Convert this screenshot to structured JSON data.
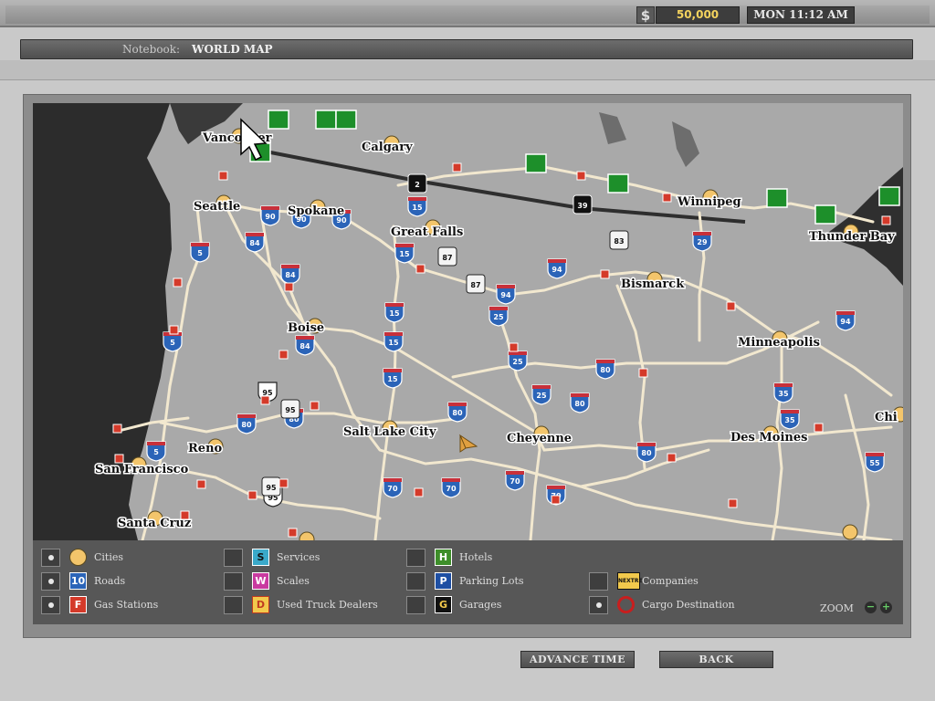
{
  "header": {
    "currency_symbol": "$",
    "money": "50,000",
    "time": "MON 11:12 AM"
  },
  "notebook": {
    "label": "Notebook:",
    "title": "WORLD MAP"
  },
  "map": {
    "cities": [
      {
        "name": "Vancouver"
      },
      {
        "name": "Calgary"
      },
      {
        "name": "Seattle"
      },
      {
        "name": "Spokane"
      },
      {
        "name": "Great Falls"
      },
      {
        "name": "Winnipeg"
      },
      {
        "name": "Thunder Bay"
      },
      {
        "name": "Bismarck"
      },
      {
        "name": "Boise"
      },
      {
        "name": "Minneapolis"
      },
      {
        "name": "Salt Lake City"
      },
      {
        "name": "Cheyenne"
      },
      {
        "name": "Des Moines"
      },
      {
        "name": "Chi"
      },
      {
        "name": "Reno"
      },
      {
        "name": "San Francisco"
      },
      {
        "name": "Santa Cruz"
      }
    ],
    "interstates": [
      "90",
      "90",
      "90",
      "84",
      "84",
      "84",
      "5",
      "5",
      "5",
      "15",
      "15",
      "15",
      "15",
      "15",
      "94",
      "94",
      "94",
      "29",
      "25",
      "25",
      "25",
      "80",
      "80",
      "80",
      "80",
      "80",
      "80",
      "35",
      "35",
      "55",
      "70",
      "70",
      "70",
      "70",
      "95",
      "95"
    ],
    "us_routes": [
      "2",
      "39",
      "83",
      "87",
      "87",
      "95",
      "95"
    ],
    "colors": {
      "land": "#a9a9a9",
      "water": "#2c2c2c",
      "road": "#f2e8cf",
      "interstate": "#2b64b8",
      "city": "#f3c56b"
    }
  },
  "legend": {
    "items": [
      {
        "label": "Cities",
        "icon": "city-icon",
        "checked": true
      },
      {
        "label": "Roads",
        "icon": "interstate-shield-icon",
        "icon_text": "10",
        "checked": true
      },
      {
        "label": "Gas Stations",
        "icon": "gas-station-icon",
        "icon_text": "F",
        "checked": true
      },
      {
        "label": "Services",
        "icon": "services-icon",
        "icon_text": "S",
        "checked": false
      },
      {
        "label": "Scales",
        "icon": "scales-icon",
        "icon_text": "W",
        "checked": false
      },
      {
        "label": "Used Truck Dealers",
        "icon": "used-truck-dealer-icon",
        "icon_text": "D",
        "checked": false
      },
      {
        "label": "Hotels",
        "icon": "hotel-icon",
        "icon_text": "H",
        "checked": false
      },
      {
        "label": "Parking Lots",
        "icon": "parking-icon",
        "icon_text": "P",
        "checked": false
      },
      {
        "label": "Garages",
        "icon": "garage-icon",
        "icon_text": "G",
        "checked": false
      },
      {
        "label": "Companies",
        "icon": "company-icon",
        "icon_text": "NEXTRE",
        "checked": false
      },
      {
        "label": "Cargo Destination",
        "icon": "cargo-destination-icon",
        "checked": true
      }
    ],
    "zoom_label": "ZOOM",
    "zoom_out": "−",
    "zoom_in": "+"
  },
  "buttons": {
    "advance_time": "ADVANCE TIME",
    "back": "BACK"
  }
}
